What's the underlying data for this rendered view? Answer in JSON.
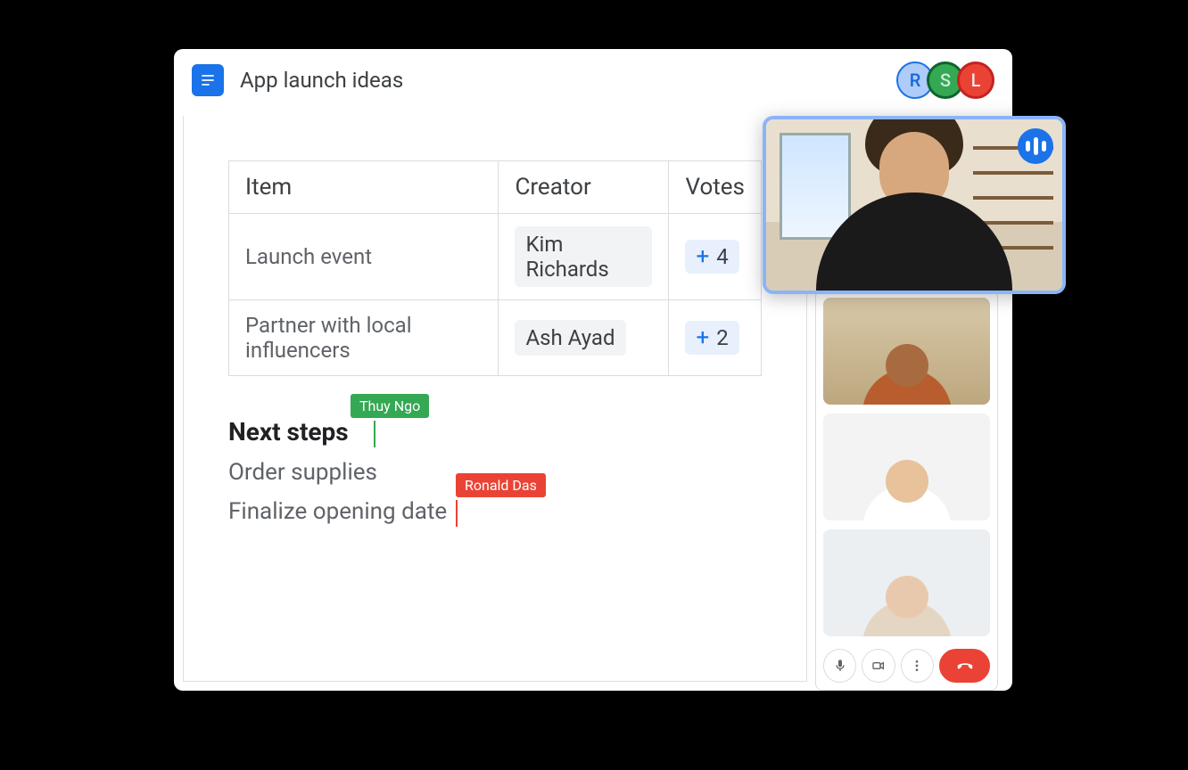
{
  "header": {
    "title": "App launch ideas",
    "collaborators": [
      {
        "initial": "R",
        "class": "r"
      },
      {
        "initial": "S",
        "class": "s"
      },
      {
        "initial": "L",
        "class": "l"
      }
    ]
  },
  "table": {
    "headers": {
      "item": "Item",
      "creator": "Creator",
      "votes": "Votes"
    },
    "rows": [
      {
        "item": "Launch event",
        "creator": "Kim Richards",
        "votes": "4"
      },
      {
        "item": "Partner with local influencers",
        "creator": "Ash Ayad",
        "votes": "2"
      }
    ]
  },
  "section": {
    "heading": "Next steps",
    "lines": [
      "Order supplies",
      "Finalize opening date"
    ]
  },
  "cursors": {
    "green": "Thuy Ngo",
    "red": "Ronald Das"
  },
  "call": {
    "controls": {
      "mic": "mic",
      "camera": "camera",
      "more": "more",
      "hangup": "hangup"
    }
  }
}
